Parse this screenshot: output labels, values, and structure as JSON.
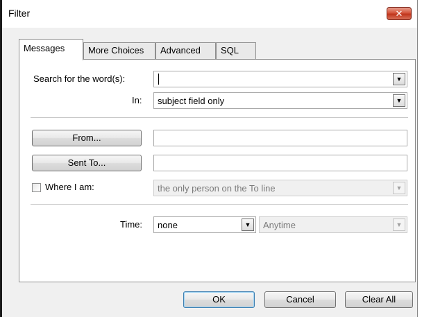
{
  "window": {
    "title": "Filter",
    "close_glyph": "✕"
  },
  "tabs": [
    {
      "label": "Messages",
      "active": true
    },
    {
      "label": "More Choices",
      "active": false
    },
    {
      "label": "Advanced",
      "active": false
    },
    {
      "label": "SQL",
      "active": false
    }
  ],
  "search": {
    "label": "Search for the word(s):",
    "value": ""
  },
  "in_field": {
    "label": "In:",
    "value": "subject field only"
  },
  "from": {
    "button_label": "From...",
    "value": ""
  },
  "sent_to": {
    "button_label": "Sent To...",
    "value": ""
  },
  "where_i_am": {
    "label": "Where I am:",
    "checked": false,
    "value": "the only person on the To line"
  },
  "time": {
    "label": "Time:",
    "value": "none",
    "range_value": "Anytime"
  },
  "buttons": {
    "ok": "OK",
    "cancel": "Cancel",
    "clear_all": "Clear All"
  },
  "icons": {
    "dropdown": "chevron-down-icon",
    "close": "close-icon"
  }
}
